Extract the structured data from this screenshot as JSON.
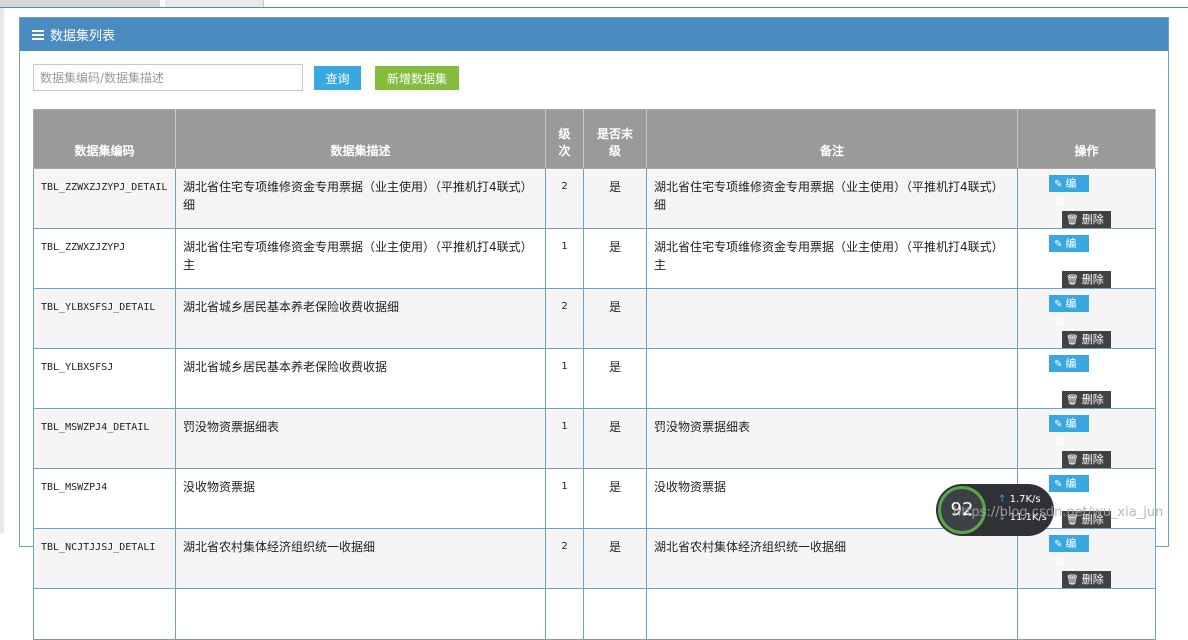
{
  "panel": {
    "title": "数据集列表"
  },
  "search": {
    "placeholder": "数据集编码/数据集描述",
    "query_label": "查询",
    "add_label": "新增数据集"
  },
  "table": {
    "headers": [
      "数据集编码",
      "数据集描述",
      "级\n次",
      "是否末\n级",
      "备注",
      "操作"
    ],
    "edit_label": "编辑",
    "delete_label": "删除",
    "rows": [
      {
        "code": "TBL_ZZWXZJZYPJ_DETAIL",
        "desc": "湖北省住宅专项维修资金专用票据（业主使用）（平推机打4联式）细",
        "level": "2",
        "leaf": "是",
        "remark": "湖北省住宅专项维修资金专用票据（业主使用）（平推机打4联式）细"
      },
      {
        "code": "TBL_ZZWXZJZYPJ",
        "desc": "湖北省住宅专项维修资金专用票据（业主使用）（平推机打4联式）主",
        "level": "1",
        "leaf": "是",
        "remark": "湖北省住宅专项维修资金专用票据（业主使用）（平推机打4联式）主"
      },
      {
        "code": "TBL_YLBXSFSJ_DETAIL",
        "desc": "湖北省城乡居民基本养老保险收费收据细",
        "level": "2",
        "leaf": "是",
        "remark": ""
      },
      {
        "code": "TBL_YLBXSFSJ",
        "desc": "湖北省城乡居民基本养老保险收费收据",
        "level": "1",
        "leaf": "是",
        "remark": ""
      },
      {
        "code": "TBL_MSWZPJ4_DETAIL",
        "desc": "罚没物资票据细表",
        "level": "1",
        "leaf": "是",
        "remark": "罚没物资票据细表"
      },
      {
        "code": "TBL_MSWZPJ4",
        "desc": "没收物资票据",
        "level": "1",
        "leaf": "是",
        "remark": "没收物资票据"
      },
      {
        "code": "TBL_NCJTJJSJ_DETALI",
        "desc": "湖北省农村集体经济组织统一收据细",
        "level": "2",
        "leaf": "是",
        "remark": "湖北省农村集体经济组织统一收据细"
      },
      {
        "code": "",
        "desc": "",
        "level": "",
        "leaf": "",
        "remark": ""
      }
    ]
  },
  "speed_widget": {
    "percent": "92",
    "up": "1.7K/s",
    "down": "11.1K/s"
  },
  "watermark": "https://blog.csdn.net/wu_xia_jun",
  "colors": {
    "header": "#4a8bc2",
    "query_button": "#39a8e0",
    "add_button": "#82bd3d",
    "table_header": "#9a9a9a",
    "delete_button": "#424242"
  }
}
